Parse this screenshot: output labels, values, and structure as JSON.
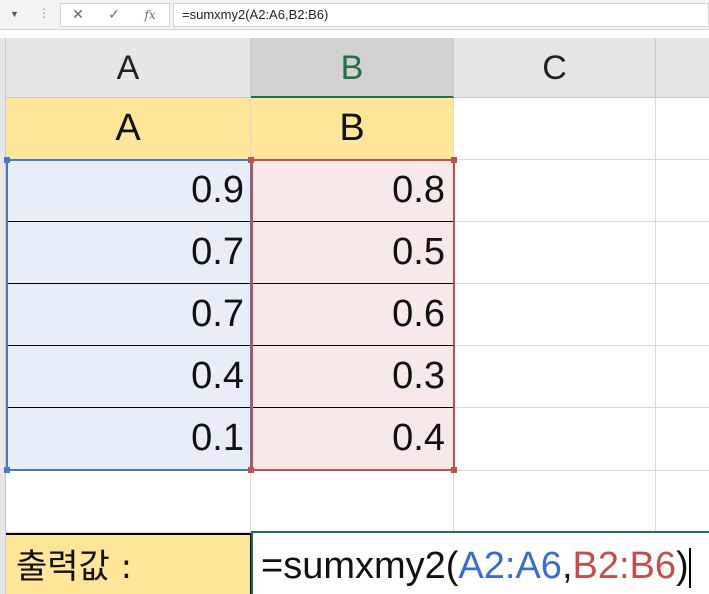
{
  "formula_bar": {
    "cancel_icon": "close-icon",
    "enter_icon": "check-icon",
    "fx_label": "fx",
    "formula_text": "=sumxmy2(A2:A6,B2:B6)"
  },
  "columns": [
    "A",
    "B",
    "C"
  ],
  "table": {
    "header_a": "A",
    "header_b": "B",
    "rows": [
      {
        "a": "0.9",
        "b": "0.8"
      },
      {
        "a": "0.7",
        "b": "0.5"
      },
      {
        "a": "0.7",
        "b": "0.6"
      },
      {
        "a": "0.4",
        "b": "0.3"
      },
      {
        "a": "0.1",
        "b": "0.4"
      }
    ]
  },
  "output": {
    "label": "출력값 :",
    "formula_prefix": "=sumxmy2(",
    "ref_a": "A2:A6",
    "comma": ",",
    "ref_b": "B2:B6",
    "formula_suffix": ")"
  },
  "colors": {
    "header_fill": "#ffe699",
    "range_a_fill": "#e7eef8",
    "range_b_fill": "#f8e9e9",
    "ref_a_color": "#3a6fc9",
    "ref_b_color": "#c0504d",
    "active_green": "#217346"
  }
}
